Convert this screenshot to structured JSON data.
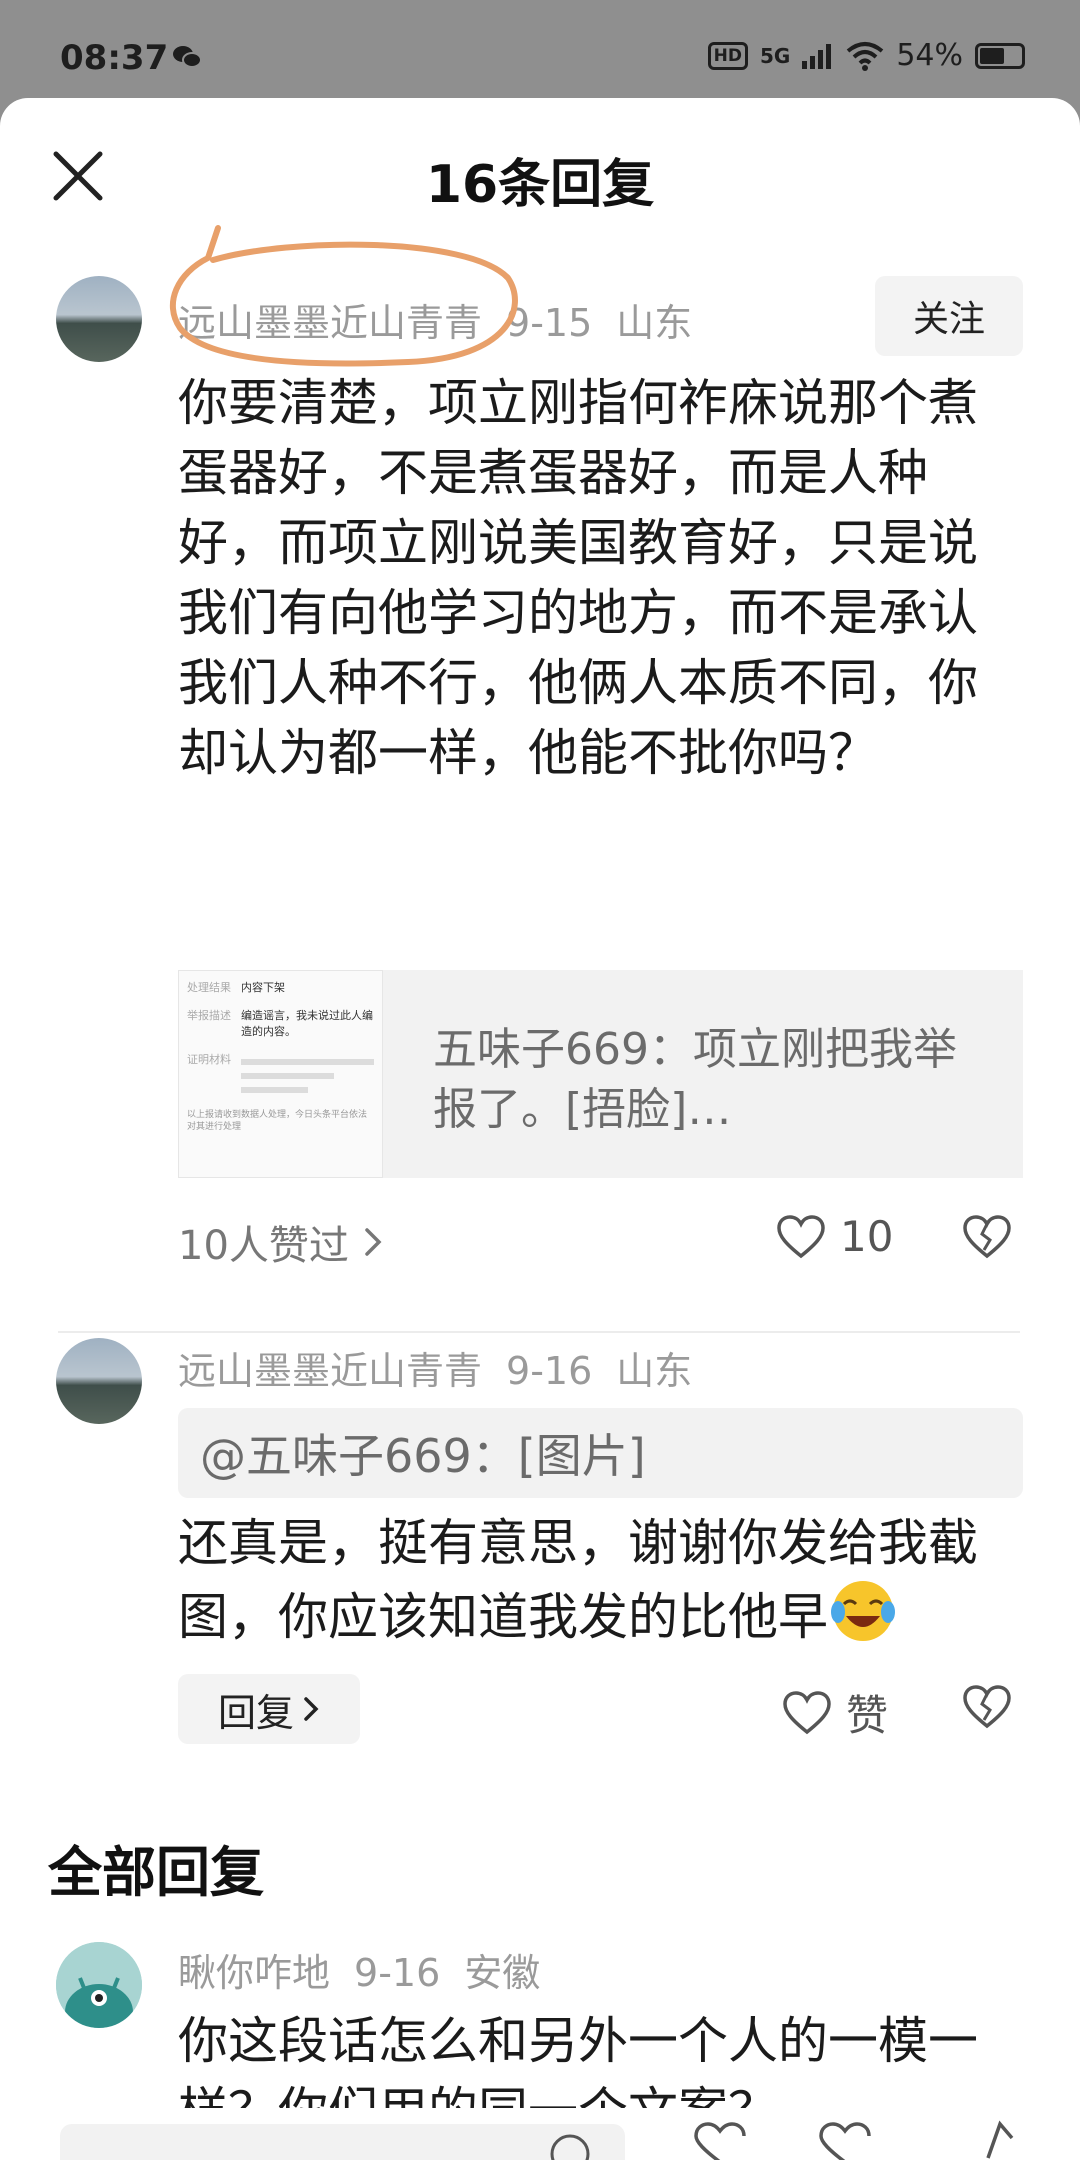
{
  "status_bar": {
    "time": "08:37",
    "network": "5G",
    "battery": "54%"
  },
  "sheet": {
    "title": "16条回复"
  },
  "main_comment": {
    "username": "远山墨墨近山青青",
    "date": "9-15",
    "location": "山东",
    "follow_label": "关注",
    "text": "你要清楚，项立刚指何祚庥说那个煮蛋器好，不是煮蛋器好，而是人种好，而项立刚说美国教育好，只是说我们有向他学习的地方，而不是承认我们人种不行，他俩人本质不同，你却认为都一样，他能不批你吗？",
    "quote": {
      "text": "五味子669：项立刚把我举报了。[捂脸]…",
      "thumb_rows": [
        {
          "k": "处理结果",
          "v": "内容下架"
        },
        {
          "k": "举报描述",
          "v": "编造谣言，我未说过此人编造的内容。"
        },
        {
          "k": "证明材料",
          "v": ""
        }
      ],
      "thumb_footer": "以上报请收到数据人处理，今日头条平台依法对其进行处理"
    },
    "likes_summary": "10人赞过",
    "like_count": "10"
  },
  "reply_comment": {
    "username": "远山墨墨近山青青",
    "date": "9-16",
    "location": "山东",
    "mention": "@五味子669：[图片]",
    "text": "还真是，挺有意思，谢谢你发给我截图，你应该知道我发的比他早",
    "reply_label": "回复",
    "like_label": "赞"
  },
  "all_replies": {
    "title": "全部回复",
    "first": {
      "username": "瞅你咋地",
      "date": "9-16",
      "location": "安徽",
      "text": "你这段话怎么和另外一个人的一模一样？你们用的同一个文案？"
    }
  },
  "colors": {
    "annotation_circle": "#e8a06a",
    "meta_text": "#9a9a9a",
    "backdrop": "#8f8f8f"
  }
}
